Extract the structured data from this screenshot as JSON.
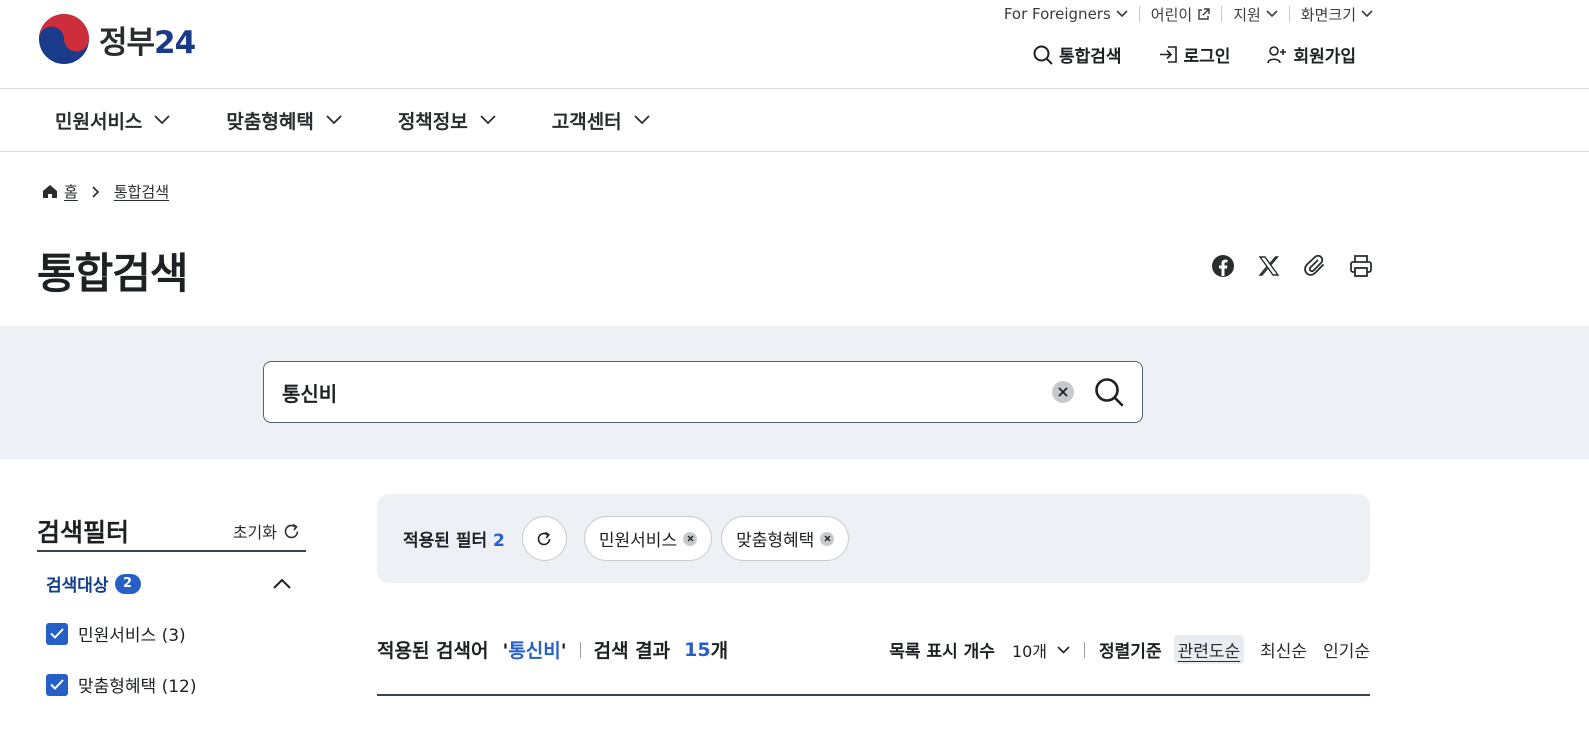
{
  "colors": {
    "brand_blue": "#2560c8",
    "band_bg": "#edf0f4",
    "dark_text": "#1e2124"
  },
  "header": {
    "logo_text": "정부",
    "logo_num": "24",
    "utility": {
      "foreigners": "For Foreigners",
      "kids": "어린이",
      "support": "지원",
      "screen_size": "화면크기"
    },
    "actions": {
      "search": "통합검색",
      "login": "로그인",
      "signup": "회원가입"
    }
  },
  "gnb": [
    "민원서비스",
    "맞춤형혜택",
    "정책정보",
    "고객센터"
  ],
  "breadcrumb": {
    "home": "홈",
    "current": "통합검색"
  },
  "page_title": "통합검색",
  "share_icons": [
    "facebook-icon",
    "x-icon",
    "link-icon",
    "print-icon"
  ],
  "search": {
    "value": "통신비"
  },
  "filter": {
    "title": "검색필터",
    "reset": "초기화",
    "group_label": "검색대상",
    "group_count": "2",
    "options": [
      {
        "label": "민원서비스 (3)",
        "checked": true
      },
      {
        "label": "맞춤형혜택 (12)",
        "checked": true
      }
    ]
  },
  "applied": {
    "label": "적용된 필터",
    "count": "2",
    "chips": [
      "민원서비스",
      "맞춤형혜택"
    ]
  },
  "results": {
    "keyword_label": "적용된 검색어",
    "keyword_open": "'",
    "keyword": "통신비",
    "keyword_close": "'",
    "result_label": "검색 결과",
    "result_count": "15",
    "result_unit": "개",
    "page_size_label": "목록 표시 개수",
    "page_size": "10개",
    "sort_label": "정렬기준",
    "sort_options": [
      "관련도순",
      "최신순",
      "인기순"
    ]
  }
}
